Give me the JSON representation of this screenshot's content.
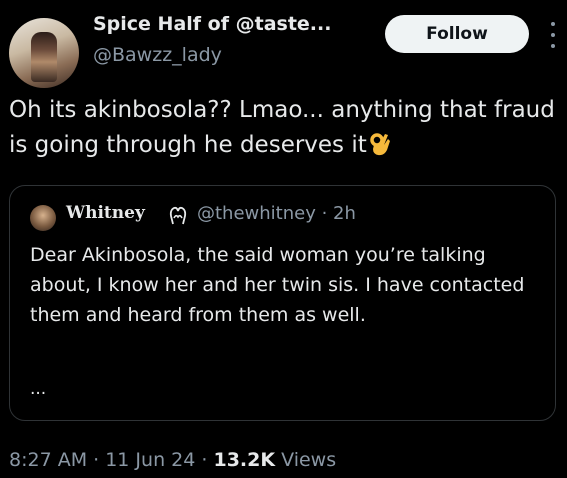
{
  "author": {
    "display_name": "Spice Half of @taste...",
    "handle": "@Bawzz_lady"
  },
  "actions": {
    "follow_label": "Follow",
    "more_icon": "more-vertical-icon"
  },
  "tweet": {
    "text": "Oh its akinbosola?? Lmao... anything that fraud is going through he deserves it",
    "emoji": "ok-hand-emoji"
  },
  "quoted": {
    "name": "Whitney",
    "badge_icon": "heart-hands-emoji",
    "handle_time": "@thewhitney · 2h",
    "text": "Dear Akinbosola, the said woman you’re talking about, I know her and her twin sis. I have contacted them and heard from them as well.",
    "ellipsis": "..."
  },
  "meta": {
    "time_date": "8:27 AM · 11 Jun 24 · ",
    "views_count": "13.2K",
    "views_label": " Views"
  },
  "colors": {
    "background": "#000000",
    "text": "#e7e9ea",
    "muted": "#8b98a5",
    "border": "#2f3336",
    "follow_bg": "#eff3f4"
  }
}
